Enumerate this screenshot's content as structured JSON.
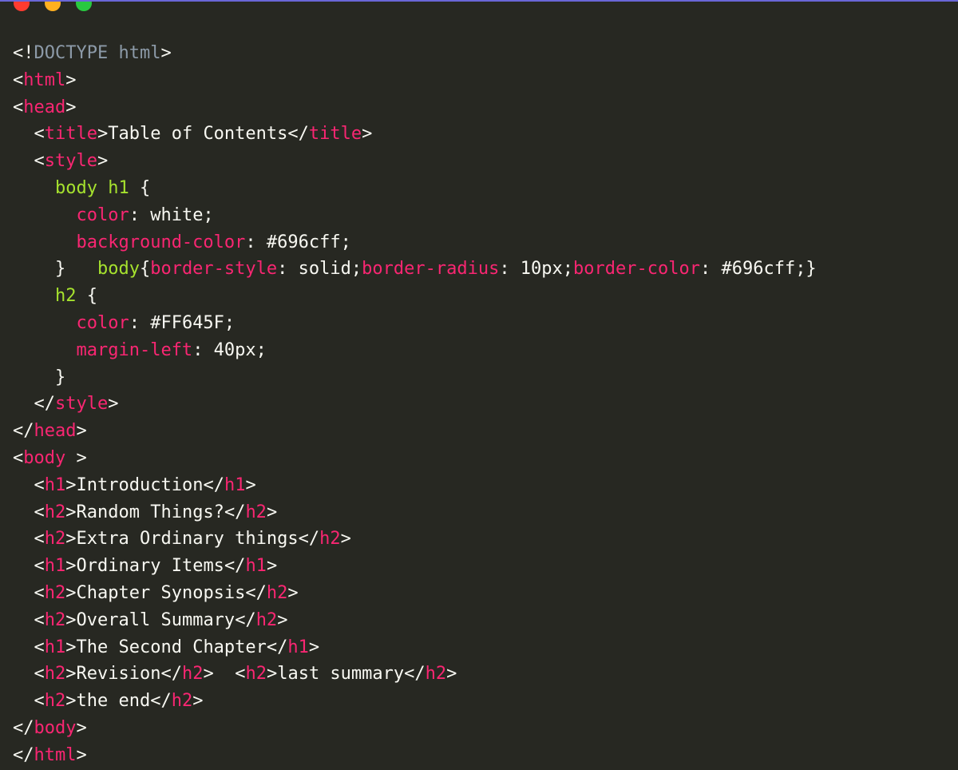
{
  "window": {
    "controls": [
      {
        "name": "close",
        "color": "#ff3b30"
      },
      {
        "name": "minimize",
        "color": "#ffb020"
      },
      {
        "name": "maximize",
        "color": "#28c840"
      }
    ],
    "accent_color": "#6a67d8"
  },
  "colors": {
    "background": "#272822",
    "text": "#f8f8f2",
    "tag": "#f92672",
    "selector": "#a6e22e",
    "doctype": "#8c9aa8"
  },
  "code": {
    "lines": [
      [
        {
          "t": "pun",
          "v": "<!"
        },
        {
          "t": "doc",
          "v": "DOCTYPE html"
        },
        {
          "t": "pun",
          "v": ">"
        }
      ],
      [
        {
          "t": "pun",
          "v": "<"
        },
        {
          "t": "tag",
          "v": "html"
        },
        {
          "t": "pun",
          "v": ">"
        }
      ],
      [
        {
          "t": "pun",
          "v": "<"
        },
        {
          "t": "tag",
          "v": "head"
        },
        {
          "t": "pun",
          "v": ">"
        }
      ],
      [
        {
          "t": "pun",
          "v": "  <"
        },
        {
          "t": "tag",
          "v": "title"
        },
        {
          "t": "pun",
          "v": ">"
        },
        {
          "t": "txt",
          "v": "Table of Contents"
        },
        {
          "t": "pun",
          "v": "</"
        },
        {
          "t": "tag",
          "v": "title"
        },
        {
          "t": "pun",
          "v": ">"
        }
      ],
      [
        {
          "t": "pun",
          "v": "  <"
        },
        {
          "t": "tag",
          "v": "style"
        },
        {
          "t": "pun",
          "v": ">"
        }
      ],
      [
        {
          "t": "pun",
          "v": "    "
        },
        {
          "t": "sel",
          "v": "body h1"
        },
        {
          "t": "pun",
          "v": " {"
        }
      ],
      [
        {
          "t": "pun",
          "v": "      "
        },
        {
          "t": "prop",
          "v": "color"
        },
        {
          "t": "pun",
          "v": ": white;"
        }
      ],
      [
        {
          "t": "pun",
          "v": "      "
        },
        {
          "t": "prop",
          "v": "background-color"
        },
        {
          "t": "pun",
          "v": ": #696cff;"
        }
      ],
      [
        {
          "t": "pun",
          "v": "    }   "
        },
        {
          "t": "sel",
          "v": "body"
        },
        {
          "t": "pun",
          "v": "{"
        },
        {
          "t": "prop",
          "v": "border-style"
        },
        {
          "t": "pun",
          "v": ": solid;"
        },
        {
          "t": "prop",
          "v": "border-radius"
        },
        {
          "t": "pun",
          "v": ": 10px;"
        },
        {
          "t": "prop",
          "v": "border-color"
        },
        {
          "t": "pun",
          "v": ": #696cff;}"
        }
      ],
      [
        {
          "t": "pun",
          "v": "    "
        },
        {
          "t": "sel",
          "v": "h2"
        },
        {
          "t": "pun",
          "v": " {"
        }
      ],
      [
        {
          "t": "pun",
          "v": "      "
        },
        {
          "t": "prop",
          "v": "color"
        },
        {
          "t": "pun",
          "v": ": #FF645F;"
        }
      ],
      [
        {
          "t": "pun",
          "v": "      "
        },
        {
          "t": "prop",
          "v": "margin-left"
        },
        {
          "t": "pun",
          "v": ": 40px;"
        }
      ],
      [
        {
          "t": "pun",
          "v": "    }"
        }
      ],
      [
        {
          "t": "pun",
          "v": "  </"
        },
        {
          "t": "tag",
          "v": "style"
        },
        {
          "t": "pun",
          "v": ">"
        }
      ],
      [
        {
          "t": "pun",
          "v": "</"
        },
        {
          "t": "tag",
          "v": "head"
        },
        {
          "t": "pun",
          "v": ">"
        }
      ],
      [
        {
          "t": "pun",
          "v": "<"
        },
        {
          "t": "tag",
          "v": "body"
        },
        {
          "t": "pun",
          "v": " >"
        }
      ],
      [
        {
          "t": "pun",
          "v": "  <"
        },
        {
          "t": "tag",
          "v": "h1"
        },
        {
          "t": "pun",
          "v": ">"
        },
        {
          "t": "txt",
          "v": "Introduction"
        },
        {
          "t": "pun",
          "v": "</"
        },
        {
          "t": "tag",
          "v": "h1"
        },
        {
          "t": "pun",
          "v": ">"
        }
      ],
      [
        {
          "t": "pun",
          "v": "  <"
        },
        {
          "t": "tag",
          "v": "h2"
        },
        {
          "t": "pun",
          "v": ">"
        },
        {
          "t": "txt",
          "v": "Random Things?"
        },
        {
          "t": "pun",
          "v": "</"
        },
        {
          "t": "tag",
          "v": "h2"
        },
        {
          "t": "pun",
          "v": ">"
        }
      ],
      [
        {
          "t": "pun",
          "v": "  <"
        },
        {
          "t": "tag",
          "v": "h2"
        },
        {
          "t": "pun",
          "v": ">"
        },
        {
          "t": "txt",
          "v": "Extra Ordinary things"
        },
        {
          "t": "pun",
          "v": "</"
        },
        {
          "t": "tag",
          "v": "h2"
        },
        {
          "t": "pun",
          "v": ">"
        }
      ],
      [
        {
          "t": "pun",
          "v": "  <"
        },
        {
          "t": "tag",
          "v": "h1"
        },
        {
          "t": "pun",
          "v": ">"
        },
        {
          "t": "txt",
          "v": "Ordinary Items"
        },
        {
          "t": "pun",
          "v": "</"
        },
        {
          "t": "tag",
          "v": "h1"
        },
        {
          "t": "pun",
          "v": ">"
        }
      ],
      [
        {
          "t": "pun",
          "v": "  <"
        },
        {
          "t": "tag",
          "v": "h2"
        },
        {
          "t": "pun",
          "v": ">"
        },
        {
          "t": "txt",
          "v": "Chapter Synopsis"
        },
        {
          "t": "pun",
          "v": "</"
        },
        {
          "t": "tag",
          "v": "h2"
        },
        {
          "t": "pun",
          "v": ">"
        }
      ],
      [
        {
          "t": "pun",
          "v": "  <"
        },
        {
          "t": "tag",
          "v": "h2"
        },
        {
          "t": "pun",
          "v": ">"
        },
        {
          "t": "txt",
          "v": "Overall Summary"
        },
        {
          "t": "pun",
          "v": "</"
        },
        {
          "t": "tag",
          "v": "h2"
        },
        {
          "t": "pun",
          "v": ">"
        }
      ],
      [
        {
          "t": "pun",
          "v": "  <"
        },
        {
          "t": "tag",
          "v": "h1"
        },
        {
          "t": "pun",
          "v": ">"
        },
        {
          "t": "txt",
          "v": "The Second Chapter"
        },
        {
          "t": "pun",
          "v": "</"
        },
        {
          "t": "tag",
          "v": "h1"
        },
        {
          "t": "pun",
          "v": ">"
        }
      ],
      [
        {
          "t": "pun",
          "v": "  <"
        },
        {
          "t": "tag",
          "v": "h2"
        },
        {
          "t": "pun",
          "v": ">"
        },
        {
          "t": "txt",
          "v": "Revision"
        },
        {
          "t": "pun",
          "v": "</"
        },
        {
          "t": "tag",
          "v": "h2"
        },
        {
          "t": "pun",
          "v": ">  <"
        },
        {
          "t": "tag",
          "v": "h2"
        },
        {
          "t": "pun",
          "v": ">"
        },
        {
          "t": "txt",
          "v": "last summary"
        },
        {
          "t": "pun",
          "v": "</"
        },
        {
          "t": "tag",
          "v": "h2"
        },
        {
          "t": "pun",
          "v": ">"
        }
      ],
      [
        {
          "t": "pun",
          "v": "  <"
        },
        {
          "t": "tag",
          "v": "h2"
        },
        {
          "t": "pun",
          "v": ">"
        },
        {
          "t": "txt",
          "v": "the end"
        },
        {
          "t": "pun",
          "v": "</"
        },
        {
          "t": "tag",
          "v": "h2"
        },
        {
          "t": "pun",
          "v": ">"
        }
      ],
      [
        {
          "t": "pun",
          "v": "</"
        },
        {
          "t": "tag",
          "v": "body"
        },
        {
          "t": "pun",
          "v": ">"
        }
      ],
      [
        {
          "t": "pun",
          "v": "</"
        },
        {
          "t": "tag",
          "v": "html"
        },
        {
          "t": "pun",
          "v": ">"
        }
      ]
    ]
  }
}
